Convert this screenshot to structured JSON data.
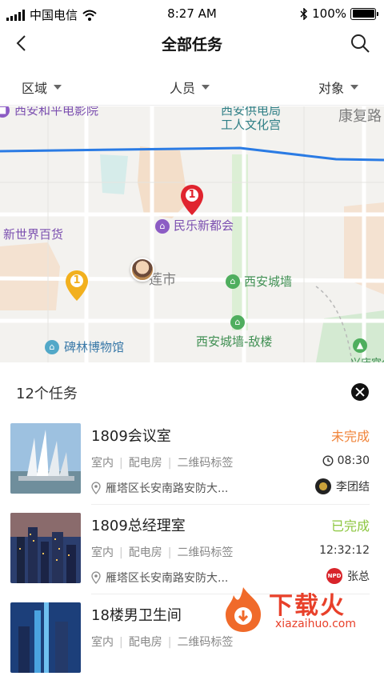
{
  "status_bar": {
    "carrier": "中国电信",
    "time": "8:27 AM",
    "battery": "100%",
    "battery_level": 1.0
  },
  "nav": {
    "title": "全部任务",
    "back_icon": "chevron-left-icon",
    "search_icon": "search-icon"
  },
  "filters": [
    {
      "label": "区域"
    },
    {
      "label": "人员"
    },
    {
      "label": "对象"
    }
  ],
  "map": {
    "labels": {
      "cinema": "西安和平电影院",
      "workers_palace_1": "西安供电局",
      "workers_palace_2": "工人文化宫",
      "kangfu": "康复路",
      "minle": "民乐新都会",
      "xinshijie": "新世界百货",
      "city": "莲市",
      "city_wall": "西安城墙",
      "city_wall_di": "西安城墙-敌楼",
      "beilin": "碑林博物馆",
      "xingqing": "兴庆宫公"
    },
    "markers": [
      {
        "label": "1",
        "color": "#e0242e"
      },
      {
        "label": "1",
        "color": "#f2b01e"
      }
    ],
    "route_color": "#2a7be4"
  },
  "panel": {
    "count_label": "12个任务",
    "tasks": [
      {
        "name": "1809会议室",
        "status": "未完成",
        "status_color": "#f0843a",
        "tags": [
          "室内",
          "配电房",
          "二维码标签"
        ],
        "time": "08:30",
        "time_icon": "clock-icon",
        "address": "雁塔区长安南路安防大...",
        "owner": "李团结"
      },
      {
        "name": "1809总经理室",
        "status": "已完成",
        "status_color": "#8cc63f",
        "tags": [
          "室内",
          "配电房",
          "二维码标签"
        ],
        "time": "12:32:12",
        "address": "雁塔区长安南路安防大...",
        "owner": "张总",
        "owner_badge": "NPD"
      },
      {
        "name": "18楼男卫生间",
        "tags": [
          "室内",
          "配电房",
          "二维码标签"
        ]
      }
    ]
  },
  "watermark": {
    "text": "下载火",
    "sub": "xiazaihuo.com"
  }
}
